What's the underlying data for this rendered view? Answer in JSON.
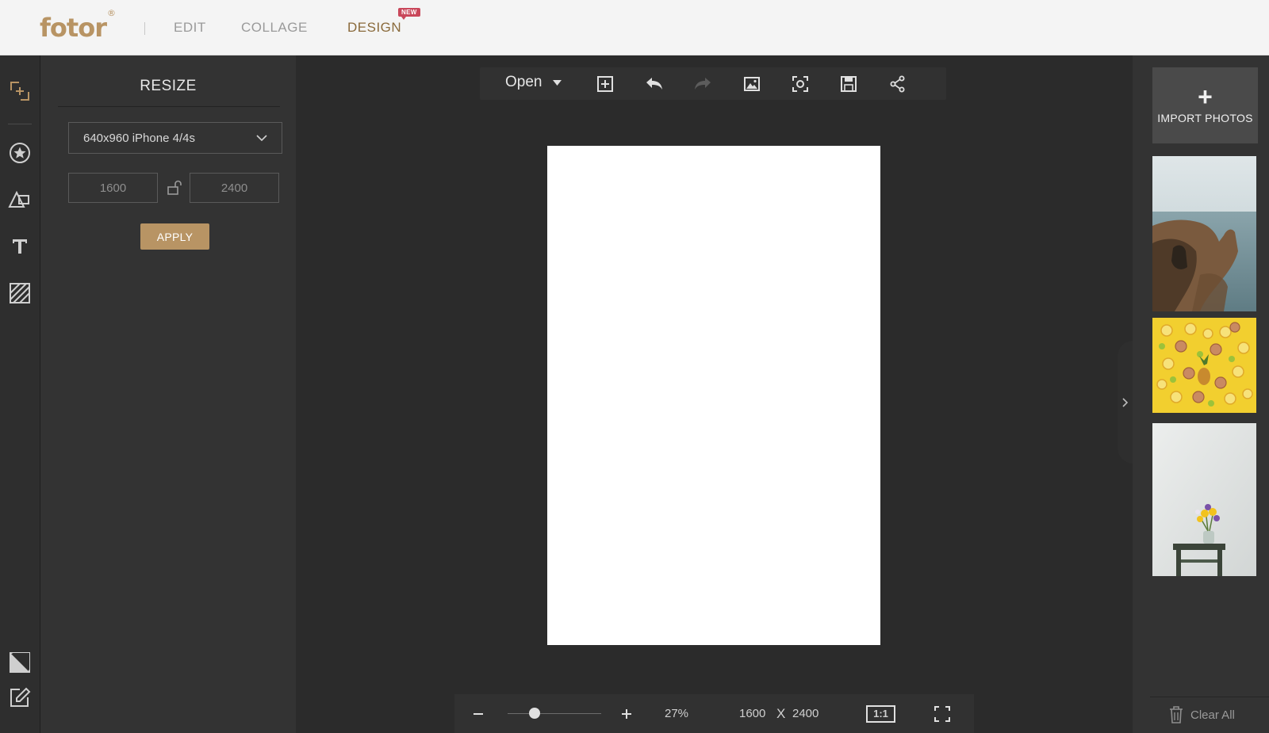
{
  "header": {
    "logo_text": "fotor",
    "logo_mark": "®",
    "tabs": [
      {
        "label": "EDIT"
      },
      {
        "label": "COLLAGE"
      },
      {
        "label": "DESIGN"
      }
    ],
    "new_badge": "NEW",
    "active_tab": "DESIGN"
  },
  "left_rail": {
    "icons": [
      "crop-add-icon",
      "star-icon",
      "shapes-icon",
      "text-icon",
      "texture-icon",
      "background-icon",
      "edit-icon"
    ]
  },
  "resize_panel": {
    "title": "RESIZE",
    "preset_value": "640x960 iPhone 4/4s",
    "width_value": "1600",
    "height_value": "2400",
    "apply_label": "APPLY"
  },
  "toolbar": {
    "open_label": "Open",
    "icons": [
      "add-layer-icon",
      "undo-icon",
      "redo-icon",
      "image-icon",
      "screenshot-icon",
      "save-icon",
      "share-icon"
    ]
  },
  "bottom_bar": {
    "zoom_percent": "27%",
    "zoom_level": 0.27,
    "canvas_width": "1600",
    "times": "X",
    "canvas_height": "2400",
    "actual_size_label": "1:1"
  },
  "right_panel": {
    "import_label": "IMPORT PHOTOS",
    "photos": [
      "coastal-cliff-photo",
      "citrus-pineapple-photo",
      "flower-vase-stool-photo"
    ],
    "clear_all_label": "Clear All"
  },
  "colors": {
    "accent": "#b89464",
    "background": "#2b2b2b",
    "panel": "#333333",
    "badge": "#c9475a"
  }
}
